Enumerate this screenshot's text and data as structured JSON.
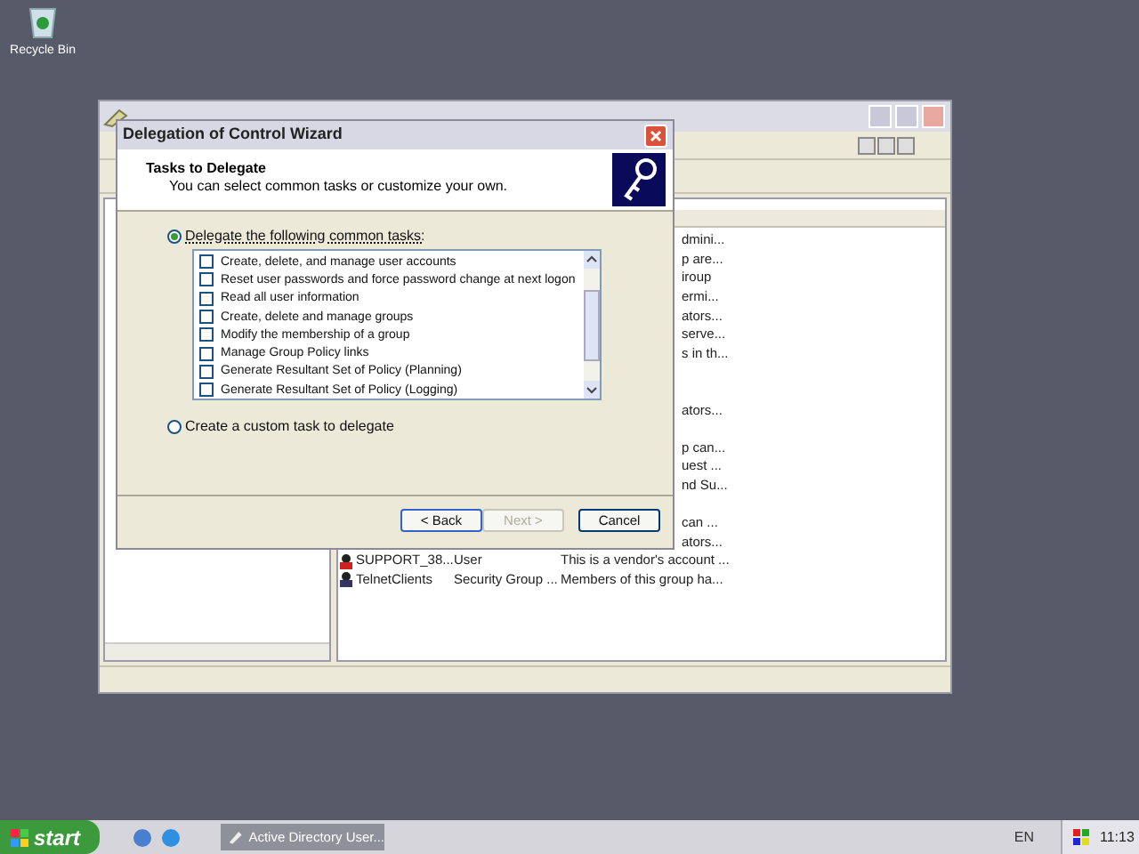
{
  "desktop": {
    "icons": [
      {
        "label": "Recycle Bin"
      }
    ]
  },
  "background_window": {
    "list_rows": [
      {
        "column_1": "",
        "column_2": "",
        "column_3": "dmini..."
      },
      {
        "column_1": "",
        "column_2": "",
        "column_3": "p are..."
      },
      {
        "column_1": "",
        "column_2": "",
        "column_3": "iroup"
      },
      {
        "column_1": "",
        "column_2": "",
        "column_3": "ermi..."
      },
      {
        "column_1": "",
        "column_2": "",
        "column_3": "ators..."
      },
      {
        "column_1": "",
        "column_2": "",
        "column_3": "serve..."
      },
      {
        "column_1": "",
        "column_2": "",
        "column_3": "s in th..."
      },
      {
        "column_1": "",
        "column_2": "",
        "column_3": ""
      },
      {
        "column_1": "",
        "column_2": "",
        "column_3": ""
      },
      {
        "column_1": "",
        "column_2": "",
        "column_3": "ators..."
      },
      {
        "column_1": "",
        "column_2": "",
        "column_3": ""
      },
      {
        "column_1": "",
        "column_2": "",
        "column_3": "p can..."
      },
      {
        "column_1": "",
        "column_2": "",
        "column_3": "uest ..."
      },
      {
        "column_1": "",
        "column_2": "",
        "column_3": "nd Su..."
      },
      {
        "column_1": "",
        "column_2": "",
        "column_3": ""
      },
      {
        "column_1": "",
        "column_2": "",
        "column_3": "can ..."
      },
      {
        "column_1": "",
        "column_2": "",
        "column_3": "ators..."
      },
      {
        "column_1": "SUPPORT_38...",
        "column_2": "User",
        "column_3": "This is a vendor's account ...",
        "kind": "user"
      },
      {
        "column_1": "TelnetClients",
        "column_2": "Security Group ...",
        "column_3": "Members of this group ha...",
        "kind": "group"
      }
    ]
  },
  "dialog": {
    "title": "Delegation of Control Wizard",
    "heading": "Tasks to Delegate",
    "subheading": "You can select common tasks or customize your own.",
    "options": [
      {
        "label": "Delegate the following common tasks:",
        "selected": true
      },
      {
        "label": "Create a custom task to delegate",
        "selected": false
      }
    ],
    "tasks": [
      {
        "label": "Create, delete, and manage user accounts",
        "checked": false
      },
      {
        "label": "Reset user passwords and force password change at next logon",
        "checked": false
      },
      {
        "label": "Read all user information",
        "checked": false
      },
      {
        "label": "Create, delete and manage groups",
        "checked": false
      },
      {
        "label": "Modify the membership of a group",
        "checked": false
      },
      {
        "label": "Manage Group Policy links",
        "checked": false
      },
      {
        "label": "Generate Resultant Set of Policy (Planning)",
        "checked": false
      },
      {
        "label": "Generate Resultant Set of Policy (Logging)",
        "checked": false
      }
    ],
    "buttons": [
      {
        "label": "< Back",
        "disabled": false,
        "focused": true
      },
      {
        "label": "Next >",
        "disabled": true,
        "focused": false
      },
      {
        "label": "Cancel",
        "disabled": false,
        "focused": false
      }
    ]
  },
  "taskbar": {
    "start": "start",
    "tasks": [
      {
        "label": "Active Directory User..."
      }
    ],
    "language": "EN",
    "clock": "11:13"
  }
}
